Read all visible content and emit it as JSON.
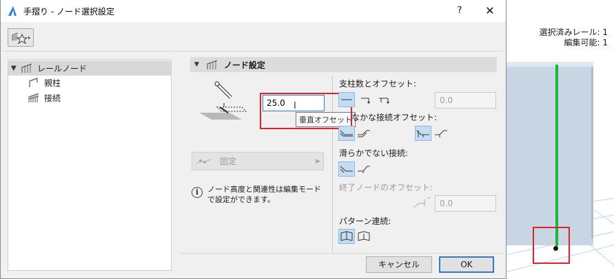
{
  "window": {
    "title": "手摺り - ノード選択設定",
    "help_glyph": "?",
    "close_glyph": "✕"
  },
  "header": {
    "selected_rails": "選択済みレール: 1",
    "editable": "編集可能: 1"
  },
  "tree": {
    "root": "レールノード",
    "children": [
      "親柱",
      "接続"
    ]
  },
  "panel": {
    "title": "ノード設定",
    "vertical_offset_value": "25.0",
    "tooltip": "垂直オフセット",
    "fix_dropdown": "固定",
    "info": "ノード高度と関連性は編集モードで設定ができます。"
  },
  "right": {
    "posts_offset_label": "支柱数とオフセット:",
    "posts_offset_value": "0.0",
    "smooth_label": "なかな接続オフセット:",
    "nonsmooth_label": "滑らかでない接続:",
    "end_node_label": "終了ノードのオフセット:",
    "end_node_value": "0.0",
    "pattern_label": "パターン連続:"
  },
  "buttons": {
    "cancel": "キャンセル",
    "ok": "OK"
  },
  "colors": {
    "accent": "#3378d0",
    "highlight": "#e0202a",
    "green_post": "#1db43c",
    "toggle_on": "#c5ddf3"
  }
}
